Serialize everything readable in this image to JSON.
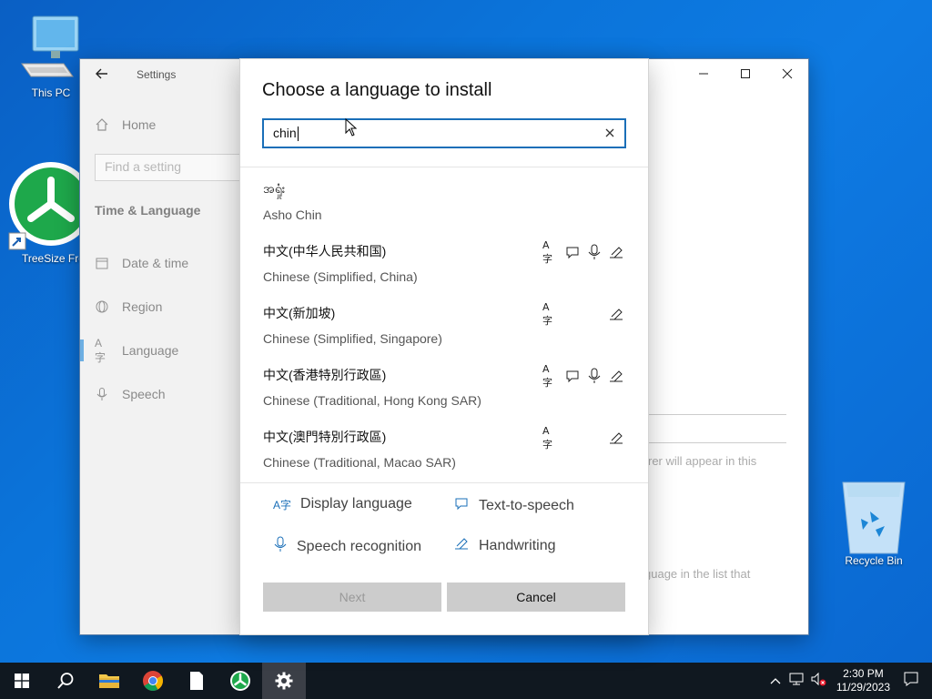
{
  "desktop": {
    "icons": [
      {
        "name": "this-pc",
        "label": "This PC"
      },
      {
        "name": "treesize",
        "label": "TreeSize Free"
      },
      {
        "name": "recycle-bin",
        "label": "Recycle Bin"
      }
    ]
  },
  "settings_window": {
    "title": "Settings",
    "controls": {
      "minimize": "—",
      "maximize": "☐",
      "close": "✕"
    },
    "sidebar": {
      "home_label": "Home",
      "search_placeholder": "Find a setting",
      "section_title": "Time & Language",
      "items": [
        {
          "label": "Date & time",
          "icon": "calendar-icon"
        },
        {
          "label": "Region",
          "icon": "globe-icon"
        },
        {
          "label": "Language",
          "icon": "language-icon",
          "selected": true
        },
        {
          "label": "Speech",
          "icon": "microphone-icon"
        }
      ]
    },
    "background_text": {
      "line1": "rer will appear in this",
      "line2": "guage in the list that"
    }
  },
  "dialog": {
    "title": "Choose a language to install",
    "search_value": "chin",
    "languages": [
      {
        "native": "အရှုံး",
        "english": "Asho Chin",
        "features": []
      },
      {
        "native": "中文(中华人民共和国)",
        "english": "Chinese (Simplified, China)",
        "features": [
          "display",
          "tts",
          "speech",
          "handwriting"
        ]
      },
      {
        "native": "中文(新加坡)",
        "english": "Chinese (Simplified, Singapore)",
        "features": [
          "display",
          "handwriting"
        ]
      },
      {
        "native": "中文(香港特別行政區)",
        "english": "Chinese (Traditional, Hong Kong SAR)",
        "features": [
          "display",
          "tts",
          "speech",
          "handwriting"
        ]
      },
      {
        "native": "中文(澳門特別行政區)",
        "english": "Chinese (Traditional, Macao SAR)",
        "features": [
          "display",
          "handwriting"
        ]
      }
    ],
    "legend": {
      "display": "Display language",
      "tts": "Text-to-speech",
      "speech": "Speech recognition",
      "handwriting": "Handwriting"
    },
    "buttons": {
      "next": "Next",
      "cancel": "Cancel"
    }
  },
  "taskbar": {
    "time": "2:30 PM",
    "date": "11/29/2023"
  },
  "colors": {
    "accent": "#0078d7",
    "search_border": "#1a6fb8",
    "taskbar": "#101820"
  }
}
